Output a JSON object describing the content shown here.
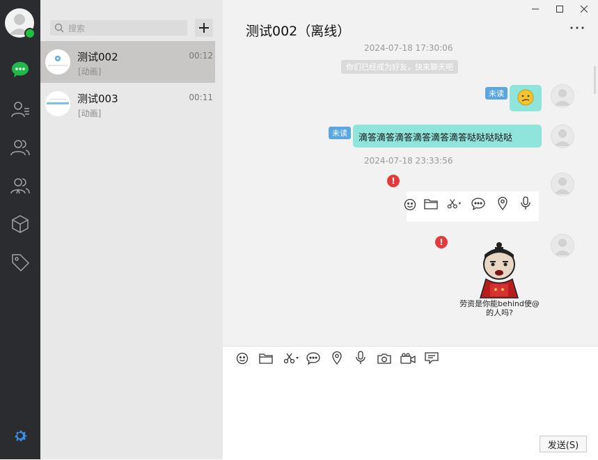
{
  "nav": {
    "items": [
      {
        "icon": "chat-icon",
        "active": true
      },
      {
        "icon": "contacts-icon"
      },
      {
        "icon": "group-icon"
      },
      {
        "icon": "team-icon"
      },
      {
        "icon": "cube-icon"
      },
      {
        "icon": "tag-icon"
      }
    ],
    "settings_icon": "gear-icon",
    "status_color": "#1fc03a"
  },
  "search": {
    "placeholder": "搜索"
  },
  "conversations": [
    {
      "name": "测试002",
      "preview": "[动画]",
      "time": "00:12",
      "active": true
    },
    {
      "name": "测试003",
      "preview": "[动画]",
      "time": "00:11",
      "active": false
    }
  ],
  "chat": {
    "title": "测试002（离线）",
    "timestamps": [
      "2024-07-18 17:30:06",
      "2024-07-18 23:33:56"
    ],
    "system_notice": "你们已经成为好友，快来聊天吧",
    "messages": [
      {
        "type": "emoji",
        "unread_label": "未读",
        "emoji": "confused-face"
      },
      {
        "type": "text",
        "unread_label": "未读",
        "text": "滴答滴答滴答滴答滴答滴答哒哒哒哒哒"
      },
      {
        "type": "image",
        "failed": true,
        "error_mark": "!"
      },
      {
        "type": "sticker",
        "failed": true,
        "error_mark": "!",
        "caption_line1": "劳资是你能behind使@",
        "caption_line2": "的人吗?"
      }
    ]
  },
  "composer": {
    "tools": [
      "emoji-icon",
      "folder-icon",
      "scissors-icon",
      "comment-icon",
      "location-icon",
      "mic-icon",
      "camera-icon",
      "video-icon",
      "message-icon"
    ],
    "send_label": "发送(S)"
  },
  "colors": {
    "bubble": "#8fe5dc",
    "unread": "#58a7e3",
    "error": "#e33b3b",
    "nav": "#2a2c30"
  }
}
